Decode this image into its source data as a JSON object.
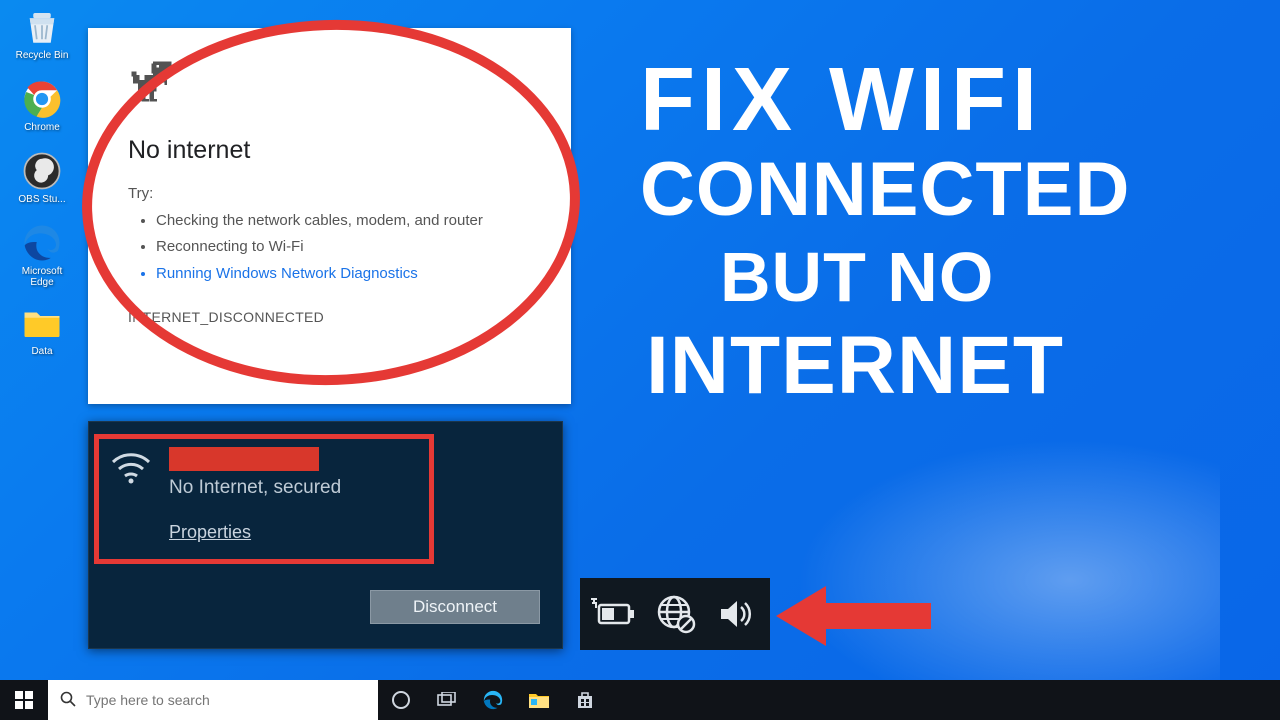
{
  "desktop": {
    "icons": [
      {
        "label": "Recycle Bin"
      },
      {
        "label": "Chrome"
      },
      {
        "label": "OBS Stu..."
      },
      {
        "label": "Microsoft Edge"
      },
      {
        "label": "Data"
      }
    ]
  },
  "error_page": {
    "heading": "No internet",
    "try_label": "Try:",
    "bullets": [
      "Checking the network cables, modem, and router",
      "Reconnecting to Wi-Fi"
    ],
    "diagnostics_link": "Running Windows Network Diagnostics",
    "error_code": "INTERNET_DISCONNECTED"
  },
  "wifi_flyout": {
    "status": "No Internet, secured",
    "properties_label": "Properties",
    "disconnect_label": "Disconnect"
  },
  "headline": {
    "line1": "FIX WIFI",
    "line2": "CONNECTED",
    "line3": "BUT NO",
    "line4": "INTERNET"
  },
  "taskbar": {
    "search_placeholder": "Type here to search"
  }
}
